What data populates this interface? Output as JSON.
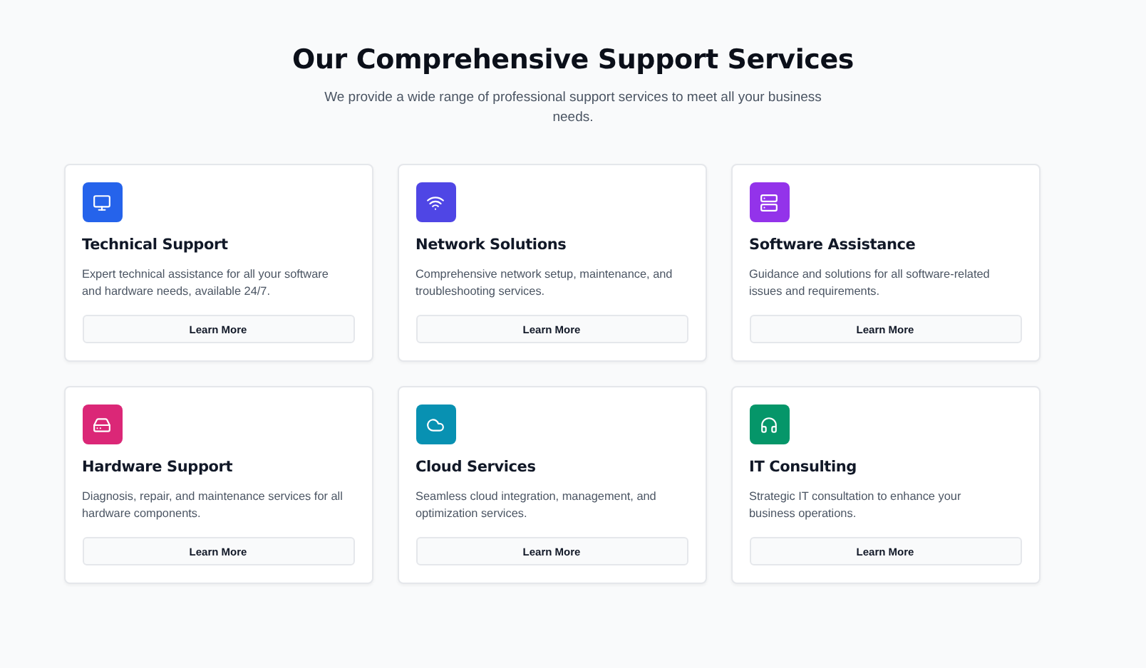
{
  "heading": "Our Comprehensive Support Services",
  "subtitle": "We provide a wide range of professional support services to meet all your business needs.",
  "services": [
    {
      "color": "#2563eb",
      "title": "Technical Support",
      "description": "Expert technical assistance for all your software and hardware needs, available 24/7.",
      "button": "Learn More"
    },
    {
      "color": "#4f46e5",
      "title": "Network Solutions",
      "description": "Comprehensive network setup, maintenance, and troubleshooting services.",
      "button": "Learn More"
    },
    {
      "color": "#9333ea",
      "title": "Software Assistance",
      "description": "Guidance and solutions for all software-related issues and requirements.",
      "button": "Learn More"
    },
    {
      "color": "#db2777",
      "title": "Hardware Support",
      "description": "Diagnosis, repair, and maintenance services for all hardware components.",
      "button": "Learn More"
    },
    {
      "color": "#0891b2",
      "title": "Cloud Services",
      "description": "Seamless cloud integration, management, and optimization services.",
      "button": "Learn More"
    },
    {
      "color": "#059669",
      "title": "IT Consulting",
      "description": "Strategic IT consultation to enhance your business operations.",
      "button": "Learn More"
    }
  ]
}
